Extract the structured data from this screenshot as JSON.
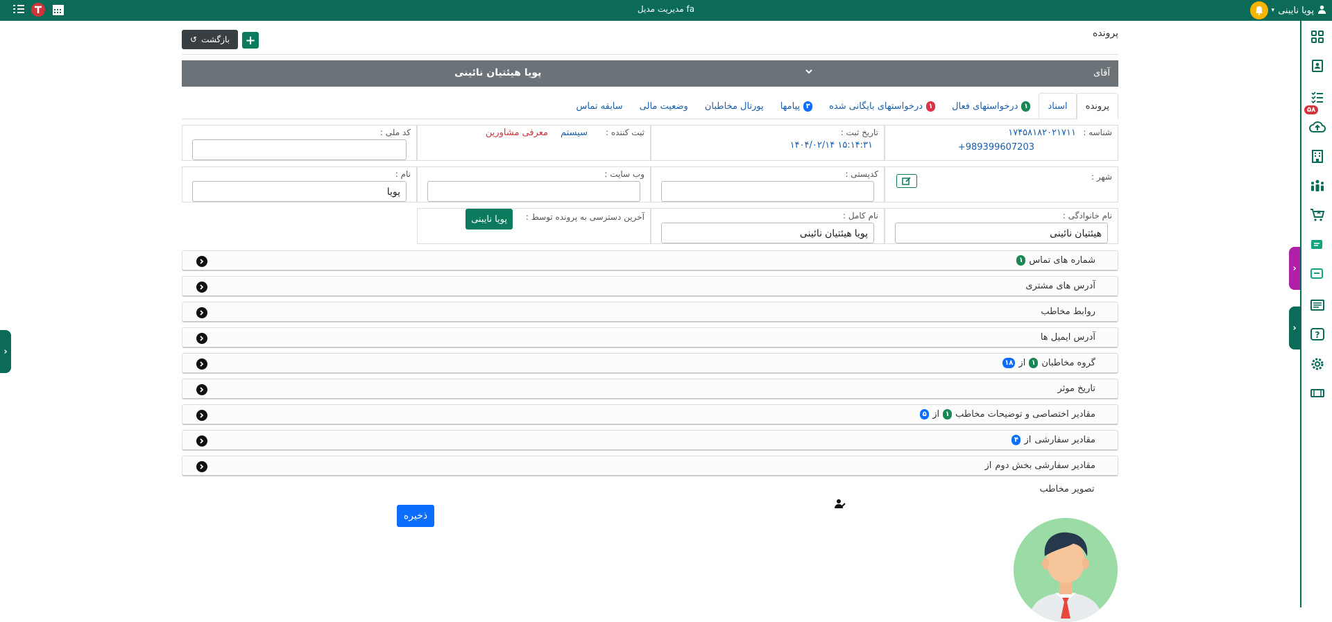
{
  "topbar": {
    "title": "مدیریت مدیل fa",
    "user_name": "پویا نایبنی"
  },
  "sidebar": {
    "badge": "۵۸"
  },
  "header": {
    "title": "پرونده",
    "back_label": "بازگشت",
    "add_label": "+"
  },
  "contact_bar": {
    "honorific": "آقای",
    "name": "پویا هیئتیان نائینی"
  },
  "tabs": [
    {
      "label": "پرونده",
      "count": ""
    },
    {
      "label": "اسناد",
      "count": ""
    },
    {
      "label": "درخواستهای فعال",
      "count": "۱"
    },
    {
      "label": "درخواستهای بایگانی شده",
      "count": "۱"
    },
    {
      "label": "پیامها",
      "count": "۳"
    },
    {
      "label": "پورتال مخاطبان",
      "count": ""
    },
    {
      "label": "وضعیت مالی",
      "count": ""
    },
    {
      "label": "سابقه تماس",
      "count": ""
    }
  ],
  "form": {
    "id_label": "شناسه :",
    "id_value": "۱۷۴۵۸۱۸۲۰۲۱۷۱۱",
    "phone_value": "+989399607203",
    "reg_date_label": "تاریخ ثبت :",
    "reg_date_value": "۱۴۰۴/۰۲/۱۴ ۱۵:۱۴:۳۱",
    "registrar_label": "ثبت کننده :",
    "registrar_value": "سیستم",
    "registrar_link": "معرفی مشاورین",
    "national_code_label": "کد ملی :",
    "national_code_value": "",
    "city_label": "شهر :",
    "postal_label": "کدپستی :",
    "postal_value": "",
    "website_label": "وب سایت :",
    "website_value": "",
    "first_name_label": "نام :",
    "first_name_value": "پویا",
    "last_name_label": "نام خانوادگی :",
    "last_name_value": "هیئتیان نائینی",
    "full_name_label": "نام کامل :",
    "full_name_value": "پویا هیئتیان نائینی",
    "last_access_label": "آخرین دسترسی به پرونده توسط :",
    "last_access_user": "پویا نایبنی"
  },
  "accordions": [
    {
      "title": "شماره های تماس",
      "c1": "۱",
      "of": "",
      "c2": ""
    },
    {
      "title": "آدرس های مشتری",
      "c1": "",
      "of": "",
      "c2": ""
    },
    {
      "title": "روابط مخاطب",
      "c1": "",
      "of": "",
      "c2": ""
    },
    {
      "title": "آدرس ایمیل ها",
      "c1": "",
      "of": "",
      "c2": ""
    },
    {
      "title": "گروه مخاطبان",
      "c1": "۱",
      "of": "از",
      "c2": "۱۸"
    },
    {
      "title": "تاریخ موثر",
      "c1": "",
      "of": "",
      "c2": ""
    },
    {
      "title": "مقادیر اختصاصی و توضیحات مخاطب",
      "c1": "۱",
      "of": "از",
      "c2": "۵"
    },
    {
      "title": "مقادیر سفارشی",
      "c1": "",
      "of": "از",
      "c2": "۴"
    },
    {
      "title": "مقادیر سفارشی بخش دوم",
      "c1": "",
      "of": "از",
      "c2": ""
    }
  ],
  "footer": {
    "save_label": "ذخیره",
    "avatar_title": "تصویر مخاطب"
  },
  "colors": {
    "primary_green": "#0c6b58",
    "bar_gray": "#6c7378",
    "link_blue": "#1a5fa8",
    "save_blue": "#0d6efd",
    "badge_red": "#d0343a"
  }
}
